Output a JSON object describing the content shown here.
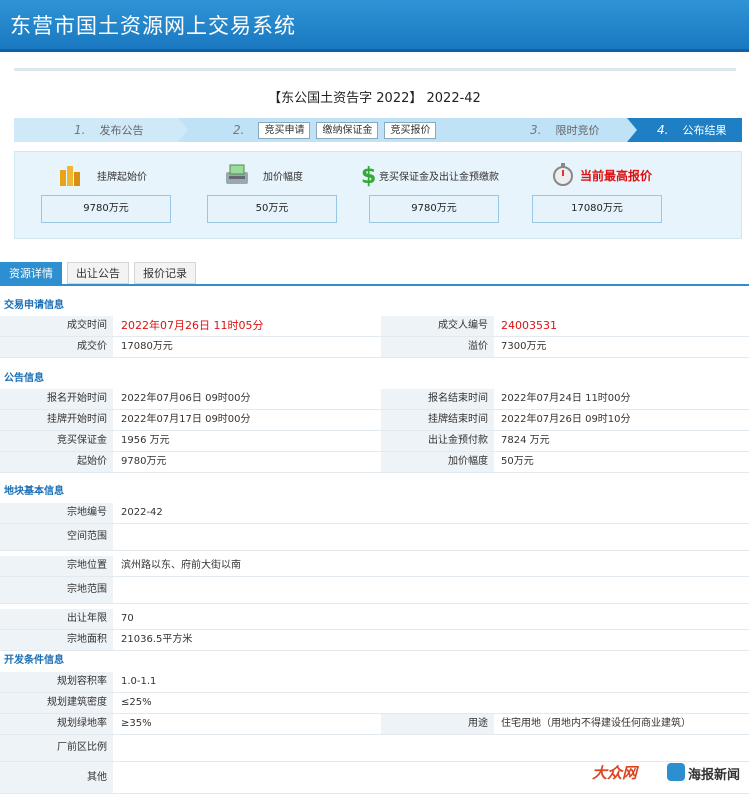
{
  "app": {
    "title": "东营市国土资源网上交易系统"
  },
  "announcement": {
    "title": "【东公国土资告字 2022】 2022-42"
  },
  "steps": [
    {
      "num": "1.",
      "label": "发布公告"
    },
    {
      "num": "2.",
      "buttons": [
        "竞买申请",
        "缴纳保证金",
        "竞买报价"
      ]
    },
    {
      "num": "3.",
      "label": "限时竞价"
    },
    {
      "num": "4.",
      "label": "公布结果"
    }
  ],
  "prices": [
    {
      "label": "挂牌起始价",
      "value": "9780万元",
      "icon": "coins-icon"
    },
    {
      "label": "加价幅度",
      "value": "50万元",
      "icon": "cash-machine-icon"
    },
    {
      "label": "竞买保证金及出让金预缴款",
      "value": "9780万元",
      "icon": "dollar-icon"
    },
    {
      "label": "当前最高报价",
      "value": "17080万元",
      "icon": "stopwatch-icon"
    }
  ],
  "tabs": [
    "资源详情",
    "出让公告",
    "报价记录"
  ],
  "sections": {
    "trade": {
      "title": "交易申请信息",
      "rows": [
        {
          "k1": "成交时间",
          "v1": "2022年07月26日 11时05分",
          "k2": "成交人编号",
          "v2": "24003531"
        },
        {
          "k1": "成交价",
          "v1": "17080万元",
          "k2": "溢价",
          "v2": "7300万元"
        }
      ]
    },
    "notice": {
      "title": "公告信息",
      "rows": [
        {
          "k1": "报名开始时间",
          "v1": "2022年07月06日 09时00分",
          "k2": "报名结束时间",
          "v2": "2022年07月24日 11时00分"
        },
        {
          "k1": "挂牌开始时间",
          "v1": "2022年07月17日 09时00分",
          "k2": "挂牌结束时间",
          "v2": "2022年07月26日 09时10分"
        },
        {
          "k1": "竞买保证金",
          "v1": "1956 万元",
          "k2": "出让金预付款",
          "v2": "7824 万元"
        },
        {
          "k1": "起始价",
          "v1": "9780万元",
          "k2": "加价幅度",
          "v2": "50万元"
        }
      ]
    },
    "land": {
      "title": "地块基本信息",
      "rows": [
        {
          "k1": "宗地编号",
          "v1": "2022-42"
        },
        {
          "k1": "空间范围",
          "v1": ""
        },
        {
          "k1": "宗地位置",
          "v1": "滨州路以东、府前大街以南"
        },
        {
          "k1": "宗地范围",
          "v1": ""
        },
        {
          "k1": "出让年限",
          "v1": "70"
        },
        {
          "k1": "宗地面积",
          "v1": "21036.5平方米"
        }
      ]
    },
    "dev": {
      "title": "开发条件信息",
      "rows": [
        {
          "k1": "规划容积率",
          "v1": "1.0-1.1"
        },
        {
          "k1": "规划建筑密度",
          "v1": "≤25%"
        },
        {
          "k1": "规划绿地率",
          "v1": "≥35%",
          "k2": "用途",
          "v2": "住宅用地（用地内不得建设任何商业建筑）"
        },
        {
          "k1": "厂前区比例",
          "v1": ""
        },
        {
          "k1": "其他",
          "v1": ""
        }
      ]
    }
  },
  "watermark": {
    "left": "大众网",
    "right": "海报新闻"
  }
}
